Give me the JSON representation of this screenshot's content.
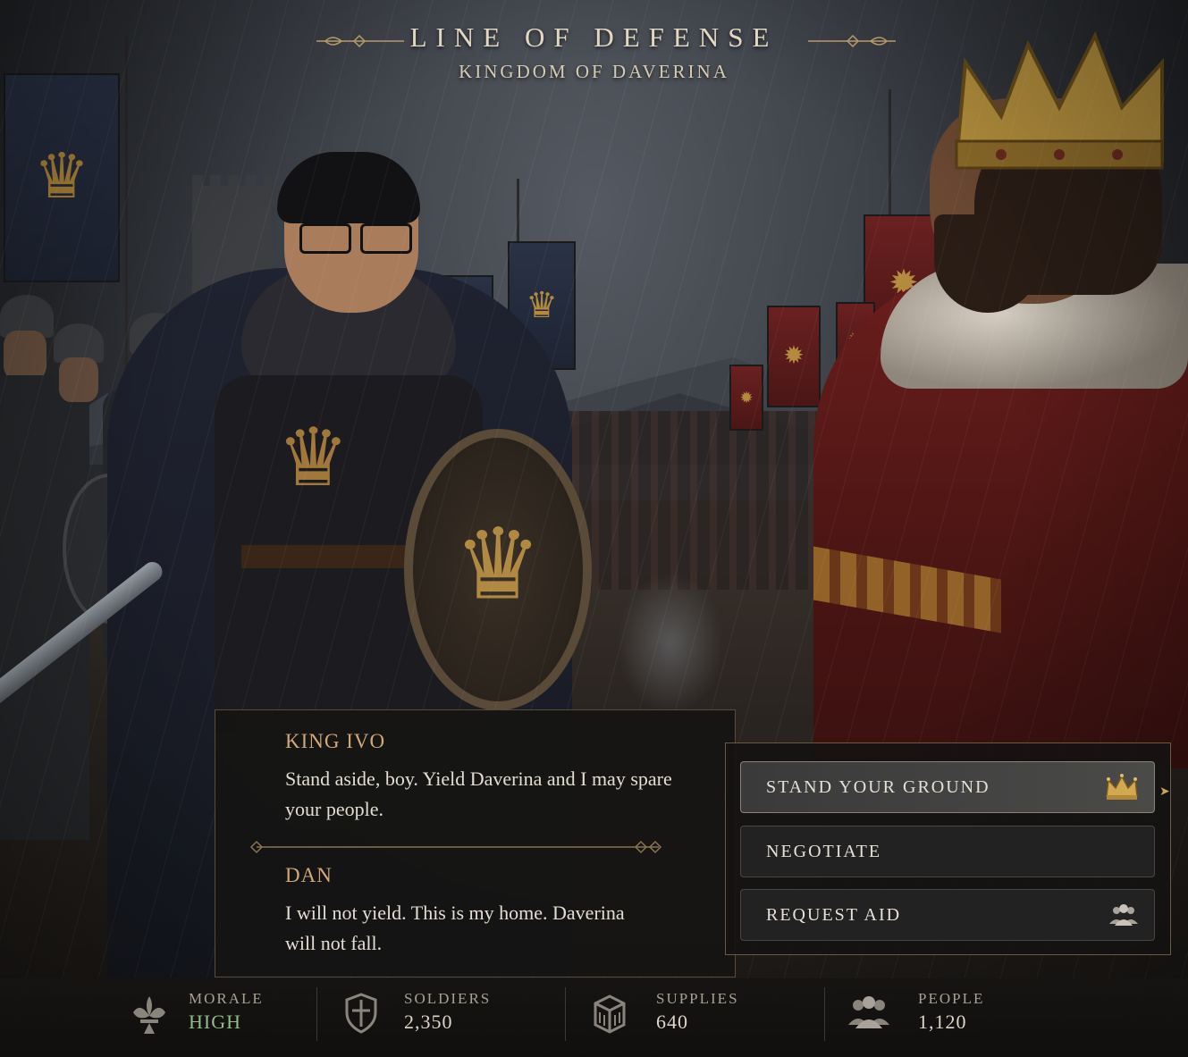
{
  "header": {
    "title": "LINE OF DEFENSE",
    "subtitle": "KINGDOM OF DAVERINA"
  },
  "dialogue": {
    "lines": [
      {
        "speaker": "KING IVO",
        "text": "Stand aside, boy. Yield Daverina and I may spare your people."
      },
      {
        "speaker": "DAN",
        "text": "I will not yield. This is my home. Daverina will not fall."
      }
    ]
  },
  "choices": [
    {
      "label": "STAND YOUR GROUND",
      "icon": "crown-icon",
      "selected": true
    },
    {
      "label": "NEGOTIATE",
      "icon": "",
      "selected": false
    },
    {
      "label": "REQUEST AID",
      "icon": "people-icon",
      "selected": false
    }
  ],
  "stats": [
    {
      "label": "MORALE",
      "value": "HIGH",
      "icon": "fleur-de-lis-icon",
      "color": "#8fbf8a"
    },
    {
      "label": "SOLDIERS",
      "value": "2,350",
      "icon": "shield-icon",
      "color": "#ded6c8"
    },
    {
      "label": "SUPPLIES",
      "value": "640",
      "icon": "crate-icon",
      "color": "#ded6c8"
    },
    {
      "label": "PEOPLE",
      "value": "1,120",
      "icon": "people-icon",
      "color": "#ded6c8"
    }
  ],
  "colors": {
    "accent_gold": "#c8a55a",
    "speaker_name": "#d3a877",
    "morale_high": "#8fbf8a",
    "banner_blue": "#2a3246",
    "banner_red": "#6a2020"
  }
}
